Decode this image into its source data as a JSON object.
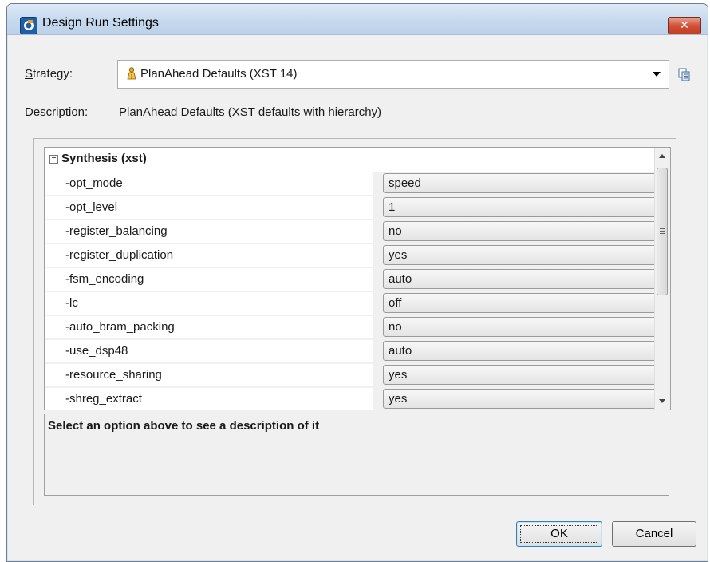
{
  "window": {
    "title": "Design Run Settings",
    "close_label": "✕"
  },
  "strategy": {
    "label_accel": "S",
    "label_rest": "trategy:",
    "value": "PlanAhead Defaults (XST 14)"
  },
  "description": {
    "label": "Description:",
    "value": "PlanAhead Defaults (XST defaults with hierarchy)"
  },
  "tree": {
    "group": {
      "expander": "−",
      "label": "Synthesis (xst)"
    },
    "rows": [
      {
        "name": "-opt_mode",
        "value": "speed"
      },
      {
        "name": "-opt_level",
        "value": "1"
      },
      {
        "name": "-register_balancing",
        "value": "no"
      },
      {
        "name": "-register_duplication",
        "value": "yes"
      },
      {
        "name": "-fsm_encoding",
        "value": "auto"
      },
      {
        "name": "-lc",
        "value": "off"
      },
      {
        "name": "-auto_bram_packing",
        "value": "no"
      },
      {
        "name": "-use_dsp48",
        "value": "auto"
      },
      {
        "name": "-resource_sharing",
        "value": "yes"
      },
      {
        "name": "-shreg_extract",
        "value": "yes"
      }
    ]
  },
  "help_text": "Select an option above to see a description of it",
  "buttons": {
    "ok": "OK",
    "cancel": "Cancel"
  },
  "colors": {
    "title_gradient": "#c6d9ee",
    "close_red": "#c33d23",
    "icon_blue": "#1f5ea8"
  }
}
